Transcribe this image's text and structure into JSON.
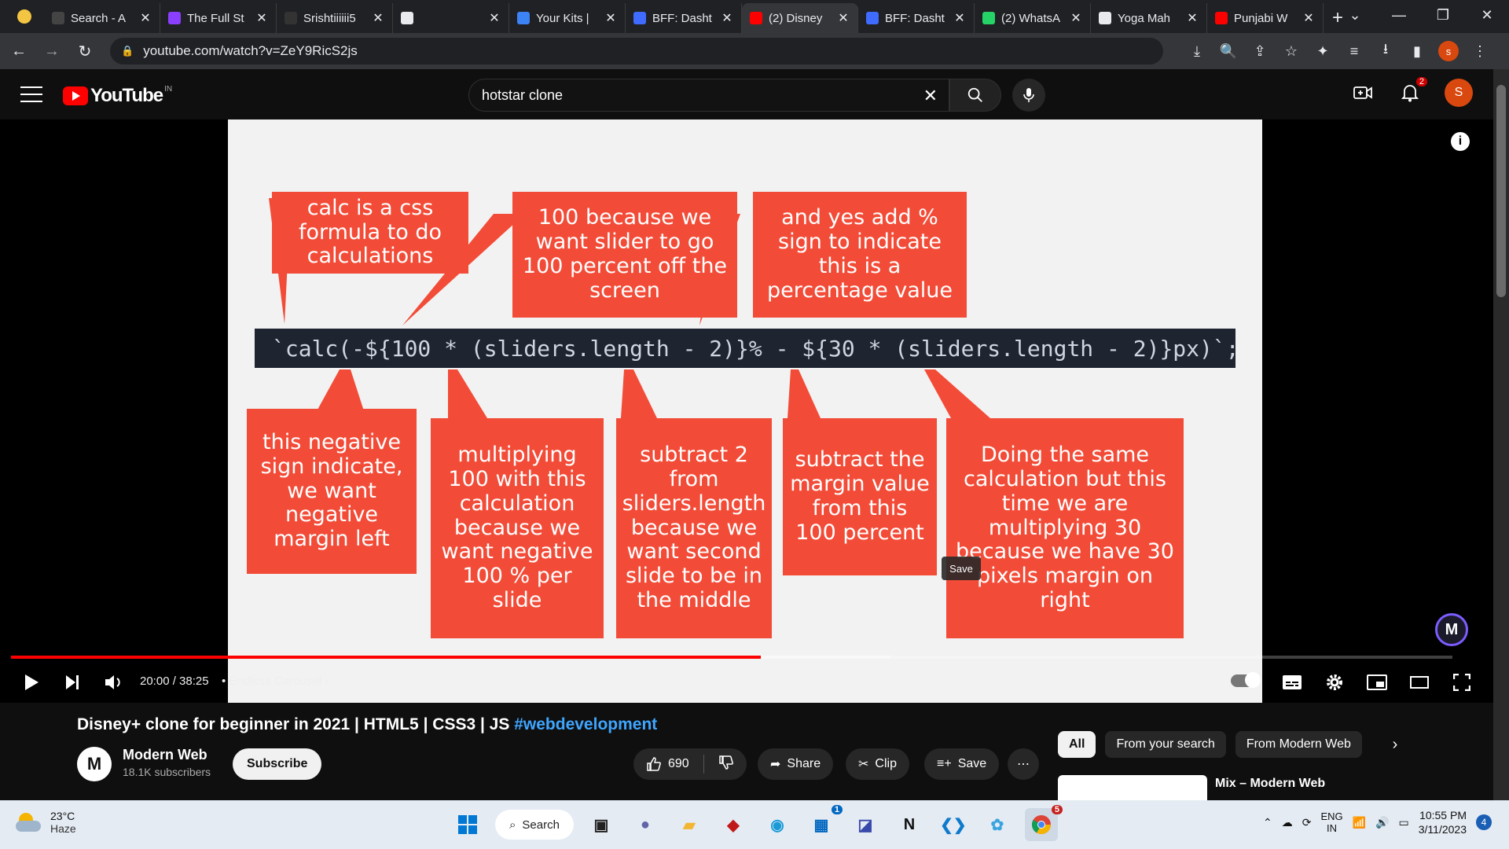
{
  "browser": {
    "tabs": [
      {
        "title": "Search - A",
        "fav_color": "#444444"
      },
      {
        "title": "The Full St",
        "fav_color": "#8a3ffc"
      },
      {
        "title": "Srishtiiiiii5",
        "fav_color": "#333333"
      },
      {
        "title": "",
        "fav_color": "#e8eaed"
      },
      {
        "title": "Your Kits |",
        "fav_color": "#3c83f6"
      },
      {
        "title": "BFF: Dasht",
        "fav_color": "#3f6bff"
      },
      {
        "title": "(2) Disney",
        "fav_color": "#ff0000"
      },
      {
        "title": "BFF: Dasht",
        "fav_color": "#3f6bff"
      },
      {
        "title": "(2) WhatsA",
        "fav_color": "#25d366"
      },
      {
        "title": "Yoga Mah",
        "fav_color": "#e8eaed"
      },
      {
        "title": "Punjabi W",
        "fav_color": "#ff0000"
      }
    ],
    "active_tab_index": 6,
    "url": "youtube.com/watch?v=ZeY9RicS2js",
    "profile_letter": "s"
  },
  "youtube": {
    "logo_text": "YouTube",
    "country_code": "IN",
    "search_value": "hotstar clone",
    "notification_count": "2",
    "avatar_letter": "S"
  },
  "player": {
    "slide": {
      "code": "`calc(-${100 * (sliders.length - 2)}% - ${30 * (sliders.length - 2)}px)`;",
      "callouts_top": [
        "calc is a css formula to do calculations",
        "100 because we want slider to go 100 percent off the screen",
        "and yes add % sign to indicate this is a percentage value"
      ],
      "callouts_bottom": [
        "this negative sign indicate, we want negative margin left",
        "multiplying 100 with this calculation because we want negative 100 % per slide",
        "subtract 2 from sliders.length because we want second slide to be in the middle",
        "subtract the margin value from this 100 percent",
        "Doing the same calculation but this time we are multiplying 30 because we have 30 pixels margin on right"
      ],
      "callout_color": "#f24c38"
    },
    "watermark_letter": "M",
    "current_time": "20:00",
    "duration": "38:25",
    "time_display": "20:00 / 38:25",
    "chapter": "Endless Carousel",
    "progress_fraction": 0.52,
    "buffered_fraction": 0.61,
    "tooltip": "Save"
  },
  "video": {
    "title": "Disney+ clone for beginner in 2021 | HTML5 | CSS3 | JS",
    "hashtag": "#webdevelopment",
    "channel": "Modern Web",
    "subscribers": "18.1K subscribers",
    "subscribe_label": "Subscribe",
    "likes": "690",
    "share_label": "Share",
    "clip_label": "Clip",
    "save_label": "Save"
  },
  "sidebar": {
    "chips": [
      "All",
      "From your search",
      "From Modern Web"
    ],
    "rec_title": "Mix – Modern Web"
  },
  "taskbar": {
    "temperature": "23°C",
    "condition": "Haze",
    "search_label": "Search",
    "lang_top": "ENG",
    "lang_bottom": "IN",
    "time": "10:55 PM",
    "date": "3/11/2023",
    "notification_count": "4",
    "teams_badge": "1",
    "chrome_badge": "5"
  }
}
